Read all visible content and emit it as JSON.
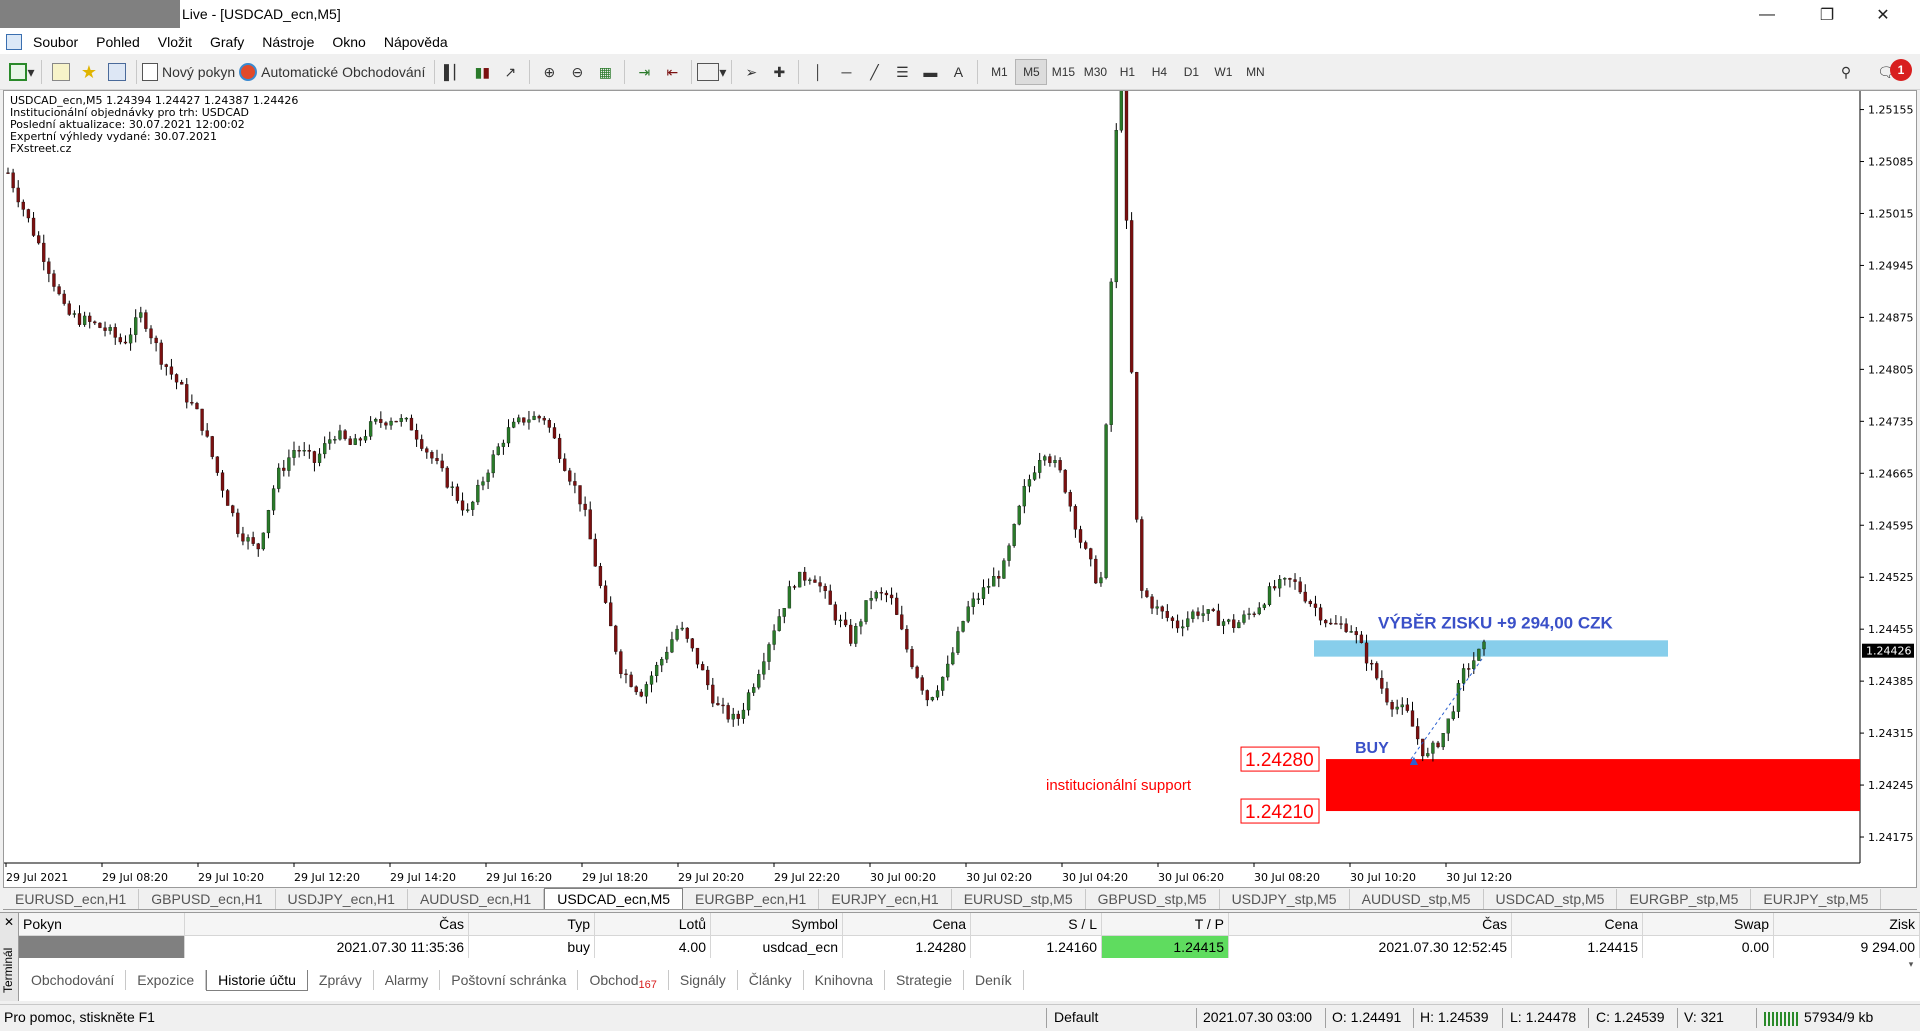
{
  "window": {
    "title": "Live - [USDCAD_ecn,M5]",
    "controls": [
      "minimize-icon",
      "restore-icon",
      "close-icon"
    ]
  },
  "menu": [
    "Soubor",
    "Pohled",
    "Vložit",
    "Grafy",
    "Nástroje",
    "Okno",
    "Nápověda"
  ],
  "toolbar": {
    "new_order": "Nový pokyn",
    "auto_trading": "Automatické Obchodování",
    "text_tool": "A",
    "timeframes": [
      "M1",
      "M5",
      "M15",
      "M30",
      "H1",
      "H4",
      "D1",
      "W1",
      "MN"
    ],
    "active_timeframe": "M5",
    "notifications": "1"
  },
  "chart_info": [
    "USDCAD_ecn,M5  1.24394 1.24427 1.24387 1.24426",
    "Institucionální objednávky pro trh: USDCAD",
    "Poslední aktualizace: 30.07.2021 12:00:02",
    "Expertní výhledy vydané: 30.07.2021",
    "FXstreet.cz"
  ],
  "chart_data": {
    "type": "candlestick",
    "symbol": "USDCAD_ecn",
    "timeframe": "M5",
    "ohlc_current": {
      "open": 1.24394,
      "high": 1.24427,
      "low": 1.24387,
      "close": 1.24426
    },
    "y_ticks": [
      "1.25155",
      "1.25085",
      "1.25015",
      "1.24945",
      "1.24875",
      "1.24805",
      "1.24735",
      "1.24665",
      "1.24595",
      "1.24525",
      "1.24455",
      "1.24385",
      "1.24315",
      "1.24245",
      "1.24175"
    ],
    "ylim": [
      1.2414,
      1.2518
    ],
    "x_ticks": [
      "29 Jul 2021",
      "29 Jul 08:20",
      "29 Jul 10:20",
      "29 Jul 12:20",
      "29 Jul 14:20",
      "29 Jul 16:20",
      "29 Jul 18:20",
      "29 Jul 20:20",
      "29 Jul 22:20",
      "30 Jul 00:20",
      "30 Jul 02:20",
      "30 Jul 04:20",
      "30 Jul 06:20",
      "30 Jul 08:20",
      "30 Jul 10:20",
      "30 Jul 12:20"
    ],
    "last_price_label": "1.24426",
    "close_path": [
      1.2507,
      1.2501,
      1.2495,
      1.2488,
      1.2487,
      1.2486,
      1.2484,
      1.2488,
      1.2482,
      1.2478,
      1.2474,
      1.2466,
      1.2459,
      1.2456,
      1.2466,
      1.247,
      1.2468,
      1.2472,
      1.247,
      1.2473,
      1.2474,
      1.2473,
      1.2469,
      1.2465,
      1.2461,
      1.2467,
      1.2472,
      1.2474,
      1.2474,
      1.2468,
      1.2462,
      1.245,
      1.244,
      1.2437,
      1.2441,
      1.2446,
      1.2441,
      1.2435,
      1.2433,
      1.2439,
      1.2446,
      1.2452,
      1.2453,
      1.2448,
      1.2444,
      1.245,
      1.245,
      1.2442,
      1.2436,
      1.244,
      1.2448,
      1.2451,
      1.2454,
      1.2464,
      1.247,
      1.2466,
      1.2457,
      1.2451,
      1.2526,
      1.2451,
      1.2448,
      1.2446,
      1.2448,
      1.2447,
      1.2446,
      1.2448,
      1.2451,
      1.2452,
      1.2449,
      1.2446,
      1.2446,
      1.2441,
      1.2436,
      1.2434,
      1.2428,
      1.2432,
      1.244,
      1.2443
    ],
    "candle_colors": {
      "up": "#2a7a2a",
      "down": "#7a1010",
      "wick": "#000000"
    },
    "annotations": {
      "profit_label": "VÝBĚR ZISKU +9 294,00 CZK",
      "profit_zone": {
        "from": 1.24418,
        "to": 1.2444,
        "color": "#87ceeb"
      },
      "buy_label": "BUY",
      "support_zone": {
        "from": 1.2421,
        "to": 1.2428,
        "color": "#ff0000"
      },
      "support_upper": "1.24280",
      "support_lower": "1.24210",
      "support_label": "institucionální support"
    }
  },
  "chart_tabs": [
    "EURUSD_ecn,H1",
    "GBPUSD_ecn,H1",
    "USDJPY_ecn,H1",
    "AUDUSD_ecn,H1",
    "USDCAD_ecn,M5",
    "EURGBP_ecn,H1",
    "EURJPY_ecn,H1",
    "EURUSD_stp,M5",
    "GBPUSD_stp,M5",
    "USDJPY_stp,M5",
    "AUDUSD_stp,M5",
    "USDCAD_stp,M5",
    "EURGBP_stp,M5",
    "EURJPY_stp,M5"
  ],
  "active_chart_tab": "USDCAD_ecn,M5",
  "terminal": {
    "side_label": "Terminál",
    "columns": [
      "Pokyn",
      "Čas",
      "Typ",
      "Lotů",
      "Symbol",
      "Cena",
      "S / L",
      "T / P",
      "Čas",
      "Cena",
      "Swap",
      "Zisk"
    ],
    "row": {
      "time_open": "2021.07.30 11:35:36",
      "type": "buy",
      "lots": "4.00",
      "symbol": "usdcad_ecn",
      "price_open": "1.24280",
      "sl": "1.24160",
      "tp": "1.24415",
      "time_close": "2021.07.30 12:52:45",
      "price_close": "1.24415",
      "swap": "0.00",
      "profit": "9 294.00"
    },
    "tabs": [
      "Obchodování",
      "Expozice",
      "Historie účtu",
      "Zprávy",
      "Alarmy",
      "Poštovní schránka",
      "Obchod",
      "Signály",
      "Články",
      "Knihovna",
      "Strategie",
      "Deník"
    ],
    "active_tab": "Historie účtu",
    "trade_badge": "167"
  },
  "status": {
    "help": "Pro pomoc, stiskněte F1",
    "profile": "Default",
    "datetime": "2021.07.30 03:00",
    "open": "O: 1.24491",
    "high": "H: 1.24539",
    "low": "L: 1.24478",
    "close": "C: 1.24539",
    "volume": "V: 321",
    "traffic": "57934/9 kb"
  }
}
